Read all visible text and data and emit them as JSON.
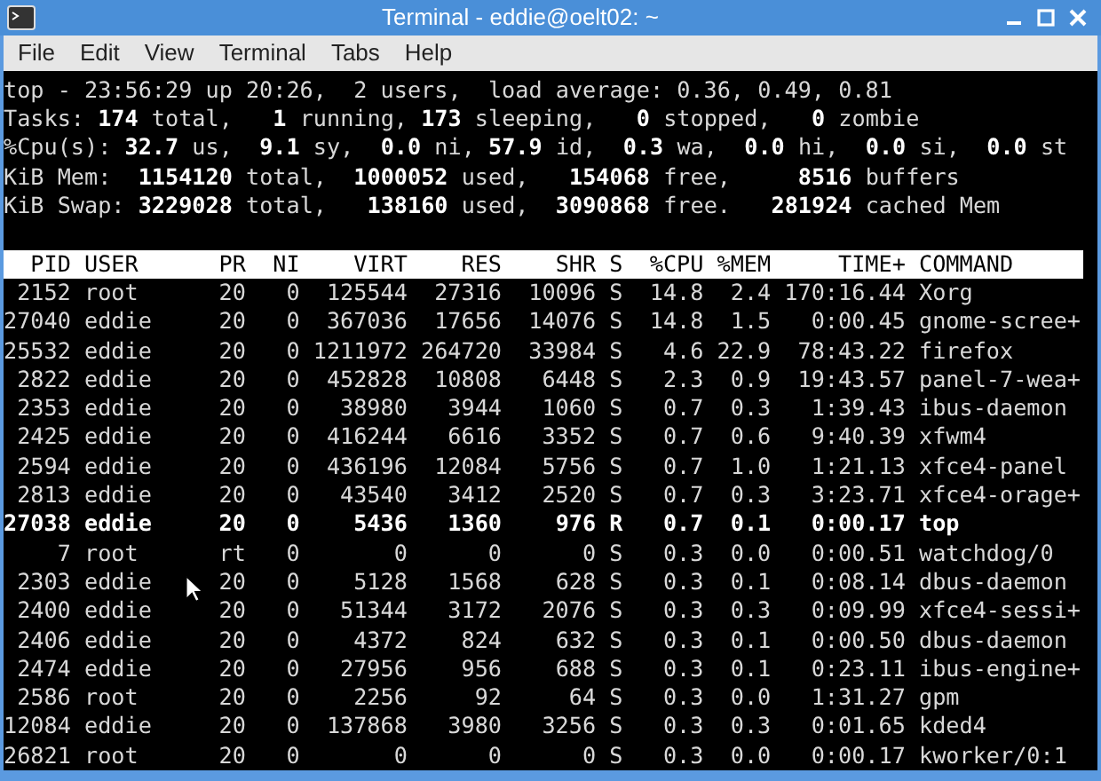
{
  "window": {
    "title": "Terminal - eddie@oelt02: ~"
  },
  "menu": [
    "File",
    "Edit",
    "View",
    "Terminal",
    "Tabs",
    "Help"
  ],
  "summary": [
    "top - 23:56:29 up 20:26,  2 users,  load average: 0.36, 0.49, 0.81",
    "Tasks: **174** total,   **1** running, **173** sleeping,   **0** stopped,   **0** zombie",
    "%Cpu(s): **32.7** us,  **9.1** sy,  **0.0** ni, **57.9** id,  **0.3** wa,  **0.0** hi,  **0.0** si,  **0.0** st",
    "KiB Mem:  **1154120** total,  **1000052** used,   **154068** free,     **8516** buffers",
    "KiB Swap: **3229028** total,   **138160** used,  **3090868** free.   **281924** cached Mem"
  ],
  "table": {
    "columns": [
      "PID",
      "USER",
      "PR",
      "NI",
      "VIRT",
      "RES",
      "SHR",
      "S",
      "%CPU",
      "%MEM",
      "TIME+",
      "COMMAND"
    ],
    "rows": [
      {
        "cells": [
          "2152",
          "root",
          "20",
          "0",
          "125544",
          "27316",
          "10096",
          "S",
          "14.8",
          "2.4",
          "170:16.44",
          "Xorg"
        ],
        "bold": false
      },
      {
        "cells": [
          "27040",
          "eddie",
          "20",
          "0",
          "367036",
          "17656",
          "14076",
          "S",
          "14.8",
          "1.5",
          "0:00.45",
          "gnome-scree+"
        ],
        "bold": false
      },
      {
        "cells": [
          "25532",
          "eddie",
          "20",
          "0",
          "1211972",
          "264720",
          "33984",
          "S",
          "4.6",
          "22.9",
          "78:43.22",
          "firefox"
        ],
        "bold": false
      },
      {
        "cells": [
          "2822",
          "eddie",
          "20",
          "0",
          "452828",
          "10808",
          "6448",
          "S",
          "2.3",
          "0.9",
          "19:43.57",
          "panel-7-wea+"
        ],
        "bold": false
      },
      {
        "cells": [
          "2353",
          "eddie",
          "20",
          "0",
          "38980",
          "3944",
          "1060",
          "S",
          "0.7",
          "0.3",
          "1:39.43",
          "ibus-daemon"
        ],
        "bold": false
      },
      {
        "cells": [
          "2425",
          "eddie",
          "20",
          "0",
          "416244",
          "6616",
          "3352",
          "S",
          "0.7",
          "0.6",
          "9:40.39",
          "xfwm4"
        ],
        "bold": false
      },
      {
        "cells": [
          "2594",
          "eddie",
          "20",
          "0",
          "436196",
          "12084",
          "5756",
          "S",
          "0.7",
          "1.0",
          "1:21.13",
          "xfce4-panel"
        ],
        "bold": false
      },
      {
        "cells": [
          "2813",
          "eddie",
          "20",
          "0",
          "43540",
          "3412",
          "2520",
          "S",
          "0.7",
          "0.3",
          "3:23.71",
          "xfce4-orage+"
        ],
        "bold": false
      },
      {
        "cells": [
          "27038",
          "eddie",
          "20",
          "0",
          "5436",
          "1360",
          "976",
          "R",
          "0.7",
          "0.1",
          "0:00.17",
          "top"
        ],
        "bold": true
      },
      {
        "cells": [
          "7",
          "root",
          "rt",
          "0",
          "0",
          "0",
          "0",
          "S",
          "0.3",
          "0.0",
          "0:00.51",
          "watchdog/0"
        ],
        "bold": false
      },
      {
        "cells": [
          "2303",
          "eddie",
          "20",
          "0",
          "5128",
          "1568",
          "628",
          "S",
          "0.3",
          "0.1",
          "0:08.14",
          "dbus-daemon"
        ],
        "bold": false
      },
      {
        "cells": [
          "2400",
          "eddie",
          "20",
          "0",
          "51344",
          "3172",
          "2076",
          "S",
          "0.3",
          "0.3",
          "0:09.99",
          "xfce4-sessi+"
        ],
        "bold": false
      },
      {
        "cells": [
          "2406",
          "eddie",
          "20",
          "0",
          "4372",
          "824",
          "632",
          "S",
          "0.3",
          "0.1",
          "0:00.50",
          "dbus-daemon"
        ],
        "bold": false
      },
      {
        "cells": [
          "2474",
          "eddie",
          "20",
          "0",
          "27956",
          "956",
          "688",
          "S",
          "0.3",
          "0.1",
          "0:23.11",
          "ibus-engine+"
        ],
        "bold": false
      },
      {
        "cells": [
          "2586",
          "root",
          "20",
          "0",
          "2256",
          "92",
          "64",
          "S",
          "0.3",
          "0.0",
          "1:31.27",
          "gpm"
        ],
        "bold": false
      },
      {
        "cells": [
          "12084",
          "eddie",
          "20",
          "0",
          "137868",
          "3980",
          "3256",
          "S",
          "0.3",
          "0.3",
          "0:01.65",
          "kded4"
        ],
        "bold": false
      },
      {
        "cells": [
          "26821",
          "root",
          "20",
          "0",
          "0",
          "0",
          "0",
          "S",
          "0.3",
          "0.0",
          "0:00.17",
          "kworker/0:1"
        ],
        "bold": false
      }
    ]
  }
}
